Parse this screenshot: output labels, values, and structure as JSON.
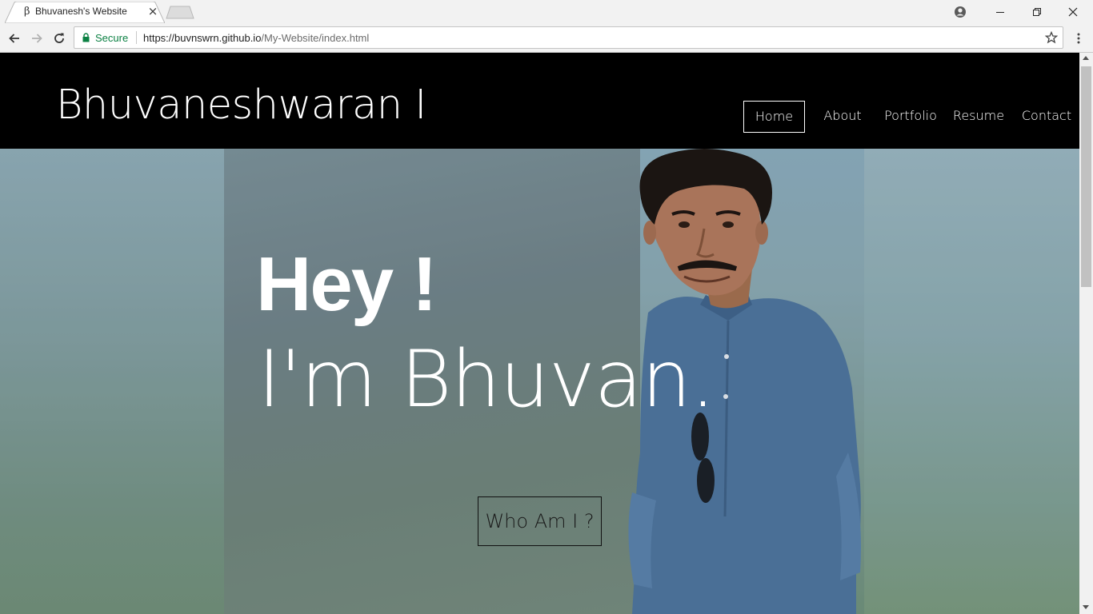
{
  "browser": {
    "tab": {
      "favicon": "β",
      "title": "Bhuvanesh's Website",
      "close": "×"
    },
    "address": {
      "secure_label": "Secure",
      "url_host": "https://buvnswrn.github.io",
      "url_path": "/My-Website/index.html"
    },
    "icons": [
      "back-icon",
      "forward-icon",
      "reload-icon",
      "lock-icon",
      "star-icon",
      "menu-icon",
      "profile-icon",
      "minimize-icon",
      "restore-icon",
      "close-icon"
    ]
  },
  "site": {
    "title": "Bhuvaneshwaran I",
    "nav": [
      {
        "label": "Home",
        "active": true
      },
      {
        "label": "About",
        "active": false
      },
      {
        "label": "Portfolio",
        "active": false
      },
      {
        "label": "Resume",
        "active": false
      },
      {
        "label": "Contact",
        "active": false
      }
    ],
    "hero": {
      "greeting": "Hey !",
      "intro": "I'm Bhuvan.",
      "cta_label": "Who Am I ?"
    }
  },
  "colors": {
    "header_bg": "#000000",
    "text_light": "#ffffff",
    "secure_green": "#0b8043"
  }
}
